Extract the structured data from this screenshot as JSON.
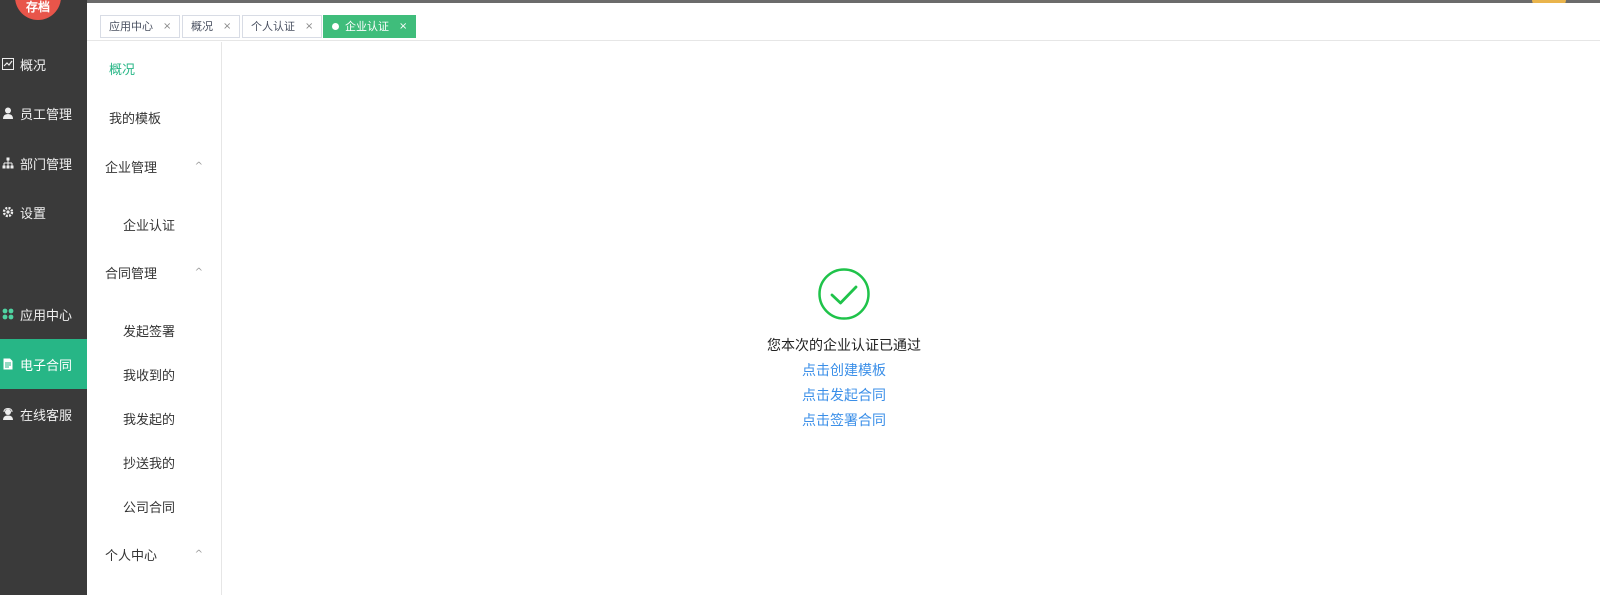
{
  "app": {
    "logo_text": "存档"
  },
  "left_rail": {
    "items": [
      {
        "label": "概况",
        "icon": "chart-line-icon"
      },
      {
        "label": "员工管理",
        "icon": "user-icon"
      },
      {
        "label": "部门管理",
        "icon": "org-chart-icon"
      },
      {
        "label": "设置",
        "icon": "gear-icon"
      },
      {
        "label": "应用中心",
        "icon": "grid-icon"
      },
      {
        "label": "电子合同",
        "icon": "document-icon"
      },
      {
        "label": "在线客服",
        "icon": "headset-icon"
      }
    ],
    "active_index": 5,
    "colors": {
      "background": "#3a3a3a",
      "active": "#27b686"
    }
  },
  "tabs": [
    {
      "label": "应用中心",
      "close": "×"
    },
    {
      "label": "概况",
      "close": "×"
    },
    {
      "label": "个人认证",
      "close": "×"
    },
    {
      "label": "企业认证",
      "close": "×"
    }
  ],
  "subnav": {
    "items": [
      {
        "label": "概况"
      },
      {
        "label": "我的模板"
      },
      {
        "label": "企业管理",
        "caret": "^"
      },
      {
        "label": "企业认证"
      },
      {
        "label": "合同管理",
        "caret": "^"
      },
      {
        "label": "发起签署"
      },
      {
        "label": "我收到的"
      },
      {
        "label": "我发起的"
      },
      {
        "label": "抄送我的"
      },
      {
        "label": "公司合同"
      },
      {
        "label": "个人中心",
        "caret": "^"
      }
    ]
  },
  "main": {
    "status_icon": "check-circle-icon",
    "message": "您本次的企业认证已通过",
    "links": [
      "点击创建模板",
      "点击发起合同",
      "点击签署合同"
    ],
    "colors": {
      "success": "#1fc34a",
      "link": "#3b8fe8"
    }
  }
}
